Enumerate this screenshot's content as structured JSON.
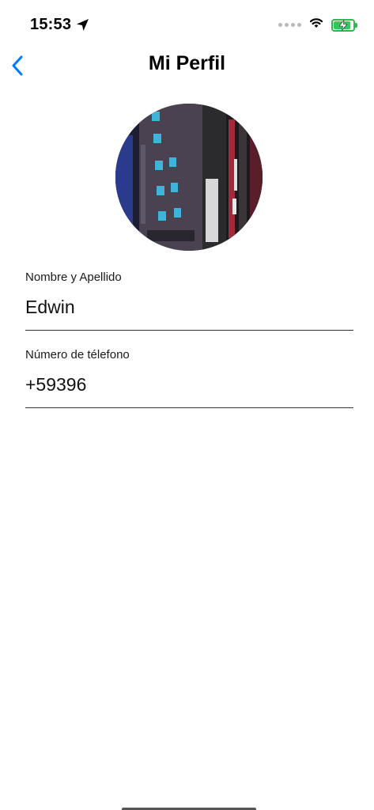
{
  "status_bar": {
    "time": "15:53",
    "location_icon": "location-arrow-icon",
    "wifi_icon": "wifi-icon",
    "battery_icon": "battery-charging-icon",
    "battery_level": 0.8,
    "battery_color": "#34c759"
  },
  "nav": {
    "back_icon": "chevron-left-icon",
    "title": "Mi Perfil",
    "accent_color": "#007aff"
  },
  "profile": {
    "avatar_icon": "profile-photo"
  },
  "fields": {
    "name": {
      "label": "Nombre y Apellido",
      "value": "Edwin"
    },
    "phone": {
      "label": "Número de télefono",
      "value": "+59396"
    }
  }
}
